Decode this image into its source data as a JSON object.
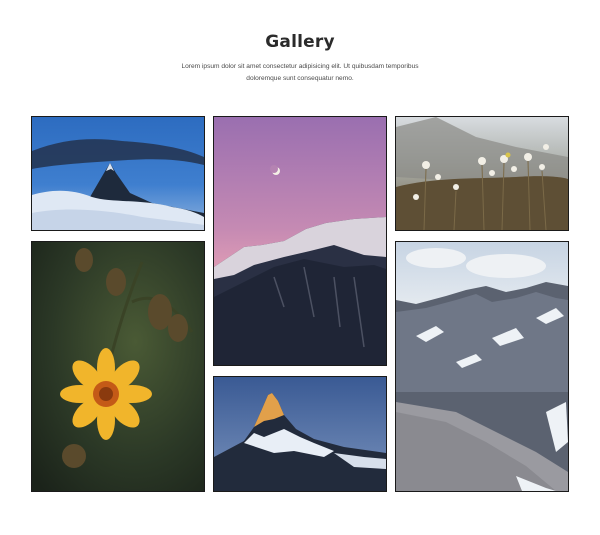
{
  "gallery": {
    "title": "Gallery",
    "description": "Lorem ipsum dolor sit amet consectetur adipisicing elit. Ut quibusdam temporibus doloremque sunt consequatur nemo."
  },
  "images": [
    {
      "subject": "Mountain peak above clouds at blue hour"
    },
    {
      "subject": "Crescent moon over snowy ridge at pink dusk"
    },
    {
      "subject": "Dry wildflowers in a mountain meadow"
    },
    {
      "subject": "Yellow flower on dark green background"
    },
    {
      "subject": "Rocky snow-dusted mountain valley"
    },
    {
      "subject": "Matterhorn peak lit by alpenglow"
    }
  ]
}
